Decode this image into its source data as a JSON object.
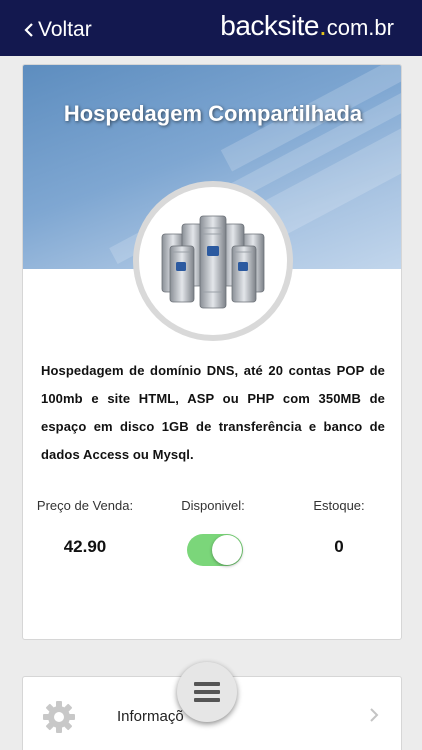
{
  "header": {
    "back_label": "Voltar",
    "brand_main": "backsite",
    "brand_dot": ".",
    "brand_tld": "com.br"
  },
  "product": {
    "title": "Hospedagem Compartilhada",
    "image_icon": "server-cluster-icon",
    "description": "Hospedagem de domínio DNS, até 20 contas POP de 100mb e site HTML, ASP ou PHP com 350MB de espaço em disco 1GB de transferência e banco de dados Access ou Mysql.",
    "price_label": "Preço de Venda:",
    "price_value": "42.90",
    "available_label": "Disponivel:",
    "available": true,
    "stock_label": "Estoque:",
    "stock_value": "0"
  },
  "info_row": {
    "label": "Informaçõ",
    "icon": "gear-icon"
  },
  "fab": {
    "icon": "menu-icon"
  },
  "colors": {
    "header_bg": "#13184f",
    "brand_dot": "#e4c31c",
    "toggle_on": "#7bd67a"
  }
}
